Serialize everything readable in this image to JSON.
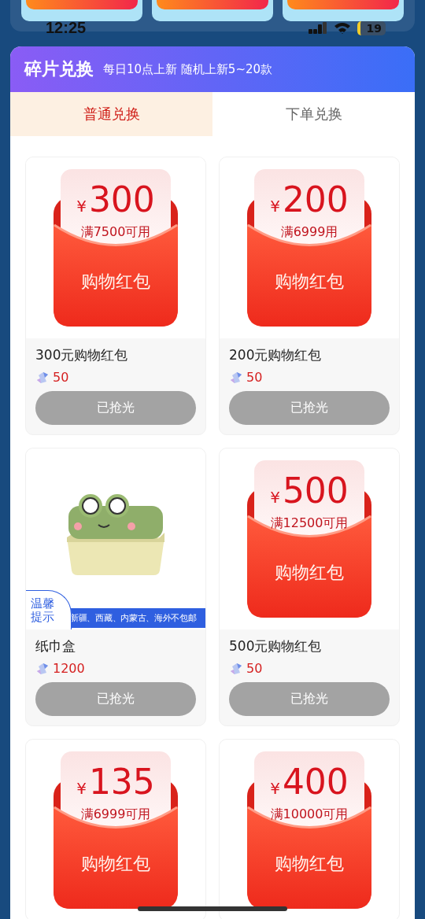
{
  "status_bar": {
    "time": "12:25",
    "battery": "19"
  },
  "panel": {
    "title": "碎片兑换",
    "subtitle": "每日10点上新 随机上新5~20款"
  },
  "tabs": [
    {
      "label": "普通兑换",
      "selected": true
    },
    {
      "label": "下单兑换",
      "selected": false
    }
  ],
  "items": [
    {
      "kind": "red-packet",
      "currency": "¥",
      "amount": "300",
      "condition": "满7500可用",
      "packet_label": "购物红包",
      "name": "300元购物红包",
      "price": "50",
      "button": "已抢光",
      "disabled": true
    },
    {
      "kind": "red-packet",
      "currency": "¥",
      "amount": "200",
      "condition": "满6999用",
      "packet_label": "购物红包",
      "name": "200元购物红包",
      "price": "50",
      "button": "已抢光",
      "disabled": true
    },
    {
      "kind": "product",
      "notice_title": "温馨提示",
      "notice_text": "新疆、西藏、内蒙古、海外不包邮",
      "name": "纸巾盒",
      "price": "1200",
      "button": "已抢光",
      "disabled": true
    },
    {
      "kind": "red-packet",
      "currency": "¥",
      "amount": "500",
      "condition": "满12500可用",
      "packet_label": "购物红包",
      "name": "500元购物红包",
      "price": "50",
      "button": "已抢光",
      "disabled": true
    },
    {
      "kind": "red-packet",
      "currency": "¥",
      "amount": "135",
      "condition": "满6999可用",
      "packet_label": "购物红包"
    },
    {
      "kind": "red-packet",
      "currency": "¥",
      "amount": "400",
      "condition": "满10000可用",
      "packet_label": "购物红包"
    }
  ]
}
